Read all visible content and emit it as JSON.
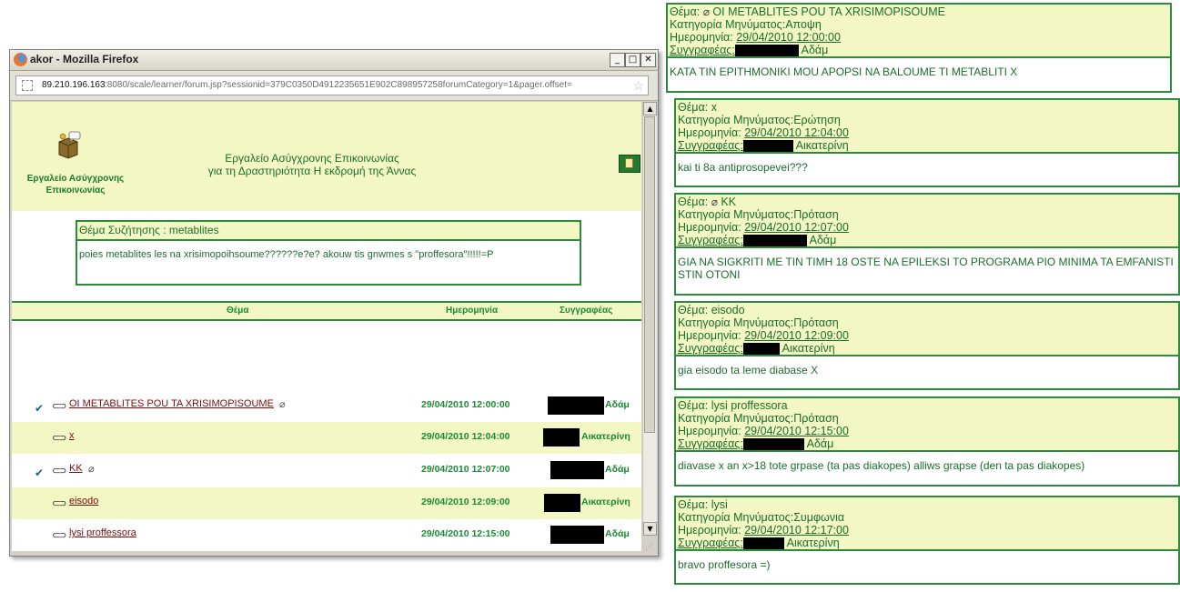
{
  "window": {
    "title": "akor - Mozilla Firefox",
    "url_host": "89.210.196.163",
    "url_rest": ":8080/scale/learner/forum.jsp?sessionid=379C0350D4912235651E902C898957258forumCategory=1&pager.offset="
  },
  "header": {
    "tool_name_line1": "Εργαλείο Ασύγχρονης",
    "tool_name_line2": "Επικοινωνίας",
    "title_line1": "Εργαλείο Ασύγχρονης Επικοινωνίας",
    "title_line2": "για τη Δραστηριότητα Η εκδρομή της Άννας"
  },
  "topic": {
    "heading": "Θέμα Συζήτησης : metablites",
    "body": "poies metablites les na xrisimopoihsoume??????e?e? akouw tis gnwmes s \"proffesora\"!!!!!=P"
  },
  "table": {
    "headers": {
      "subject": "Θέμα",
      "date": "Ημερομηνία",
      "author": "Συγγραφέας"
    },
    "rows": [
      {
        "subject": "OI METABLITES POU TA XRISIMOPISOUME",
        "date": "29/04/2010 12:00:00",
        "author": "Αδάμ",
        "checked": true,
        "attachment": true
      },
      {
        "subject": "x",
        "date": "29/04/2010 12:04:00",
        "author": "Αικατερίνη",
        "checked": false,
        "attachment": false
      },
      {
        "subject": "KK",
        "date": "29/04/2010 12:07:00",
        "author": "Αδάμ",
        "checked": true,
        "attachment": true
      },
      {
        "subject": "eisodo",
        "date": "29/04/2010 12:09:00",
        "author": "Αικατερίνη",
        "checked": false,
        "attachment": false
      },
      {
        "subject": "lysi proffessora",
        "date": "29/04/2010 12:15:00",
        "author": "Αδάμ",
        "checked": false,
        "attachment": false
      },
      {
        "subject": "lysi",
        "date": "29/04/2010 12:17:00",
        "author": "Αικατερίνη",
        "checked": false,
        "attachment": false
      }
    ]
  },
  "labels": {
    "subject": "Θέμα:",
    "category": "Κατηγορία Μηνύματος:",
    "date": "Ημερομηνία:",
    "author": "Συγγραφέας:"
  },
  "messages": [
    {
      "subject": "OI METABLITES POU TA XRISIMOPISOUME",
      "category": "Αποψη",
      "date": "29/04/2010 12:00:00",
      "author": "Αδάμ",
      "attachment": true,
      "body": "KATA TIN EPITHMONIKI MOU APOPSI NA BALOUME TI METABLITI X"
    },
    {
      "subject": "x",
      "category": "Ερώτηση",
      "date": "29/04/2010 12:04:00",
      "author": "Αικατερίνη",
      "attachment": false,
      "body": "kai ti 8a antiprosopevei???"
    },
    {
      "subject": "KK",
      "category": "Πρόταση",
      "date": "29/04/2010 12:07:00",
      "author": "Αδάμ",
      "attachment": true,
      "body": "GIA NA SIGKRITI ME TIN TIMH 18 OSTE NA EPILEKSI TO PROGRAMA PIO MINIMA TA EMFANISTI STIN OTONI"
    },
    {
      "subject": "eisodo",
      "category": "Πρόταση",
      "date": "29/04/2010 12:09:00",
      "author": "Αικατερίνη",
      "attachment": false,
      "body": "gia eisodo ta leme diabase X"
    },
    {
      "subject": "lysi proffessora",
      "category": "Πρόταση",
      "date": "29/04/2010 12:15:00",
      "author": "Αδάμ",
      "attachment": false,
      "body": "diavase x an x>18 tote grpase (ta pas diakopes) alliws grapse (den ta pas diakopes)"
    },
    {
      "subject": "lysi",
      "category": "Συμφωνια",
      "date": "29/04/2010 12:17:00",
      "author": "Αικατερίνη",
      "attachment": false,
      "body": "bravo proffesora =)"
    }
  ],
  "colors": {
    "accent_green": "#2d8a3c",
    "panel_yellow": "#f3f7c4",
    "link_red": "#7a0c0c"
  }
}
